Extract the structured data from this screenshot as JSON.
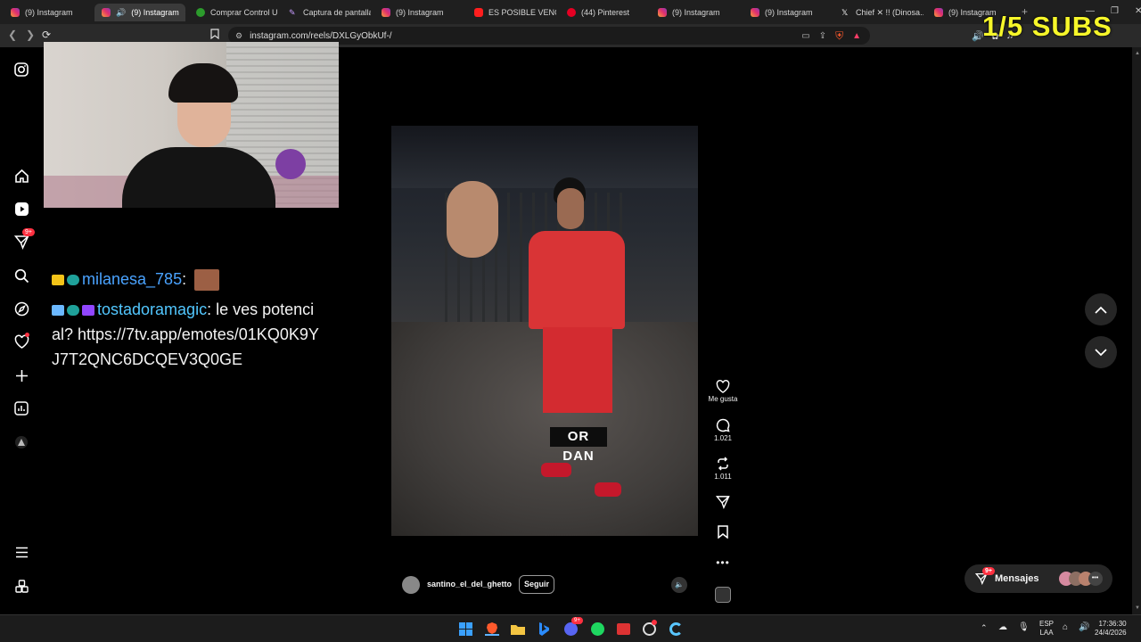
{
  "browser": {
    "tabs": [
      {
        "label": "(9) Instagram",
        "icon": "instagram-icon",
        "active": false
      },
      {
        "label": "(9) Instagram",
        "icon": "instagram-icon",
        "active": true
      },
      {
        "label": "Comprar Control U...",
        "icon": "xbox-icon",
        "active": false
      },
      {
        "label": "Captura de pantalla",
        "icon": "pen-icon",
        "active": false
      },
      {
        "label": "(9) Instagram",
        "icon": "instagram-icon",
        "active": false
      },
      {
        "label": "ES POSIBLE VENCER",
        "icon": "youtube-icon",
        "active": false
      },
      {
        "label": "(44) Pinterest",
        "icon": "pinterest-icon",
        "active": false
      },
      {
        "label": "(9) Instagram",
        "icon": "instagram-icon",
        "active": false
      },
      {
        "label": "(9) Instagram",
        "icon": "instagram-icon",
        "active": false
      },
      {
        "label": "Chief ✕ !! (Dinosa...",
        "icon": "x-icon",
        "active": false
      },
      {
        "label": "(9) Instagram",
        "icon": "instagram-icon",
        "active": false
      }
    ],
    "url": "instagram.com/reels/DXLGyObkUf-/"
  },
  "overlay": {
    "subs_counter": "1/5 SUBS"
  },
  "sidebar": {
    "notifications_badge": "9+"
  },
  "chat": {
    "msg1_user": "milanesa_785",
    "msg1_sep": ":",
    "msg2_user": "tostadoramagic",
    "msg2_text": ": le ves potencial? https://7tv.app/emotes/01KQ0K9YJ7T2QNC6DCQEV3Q0GE"
  },
  "reel": {
    "author": "santino_el_del_ghetto",
    "follow_label": "Seguir",
    "shirt_text": "OR DAN"
  },
  "actions": {
    "like_label": "Me gusta",
    "comments_count": "1.021",
    "reposts_count": "1.011"
  },
  "messages": {
    "label": "Mensajes",
    "badge": "9+"
  },
  "taskbar": {
    "lang_top": "ESP",
    "lang_bottom": "LAA",
    "time": "17:36:30",
    "date": "24/4/2026"
  },
  "colors": {
    "accent_like": "#ff3040",
    "overlay_yellow": "#f6f62a",
    "chat_user_blue": "#4aa3ff"
  }
}
